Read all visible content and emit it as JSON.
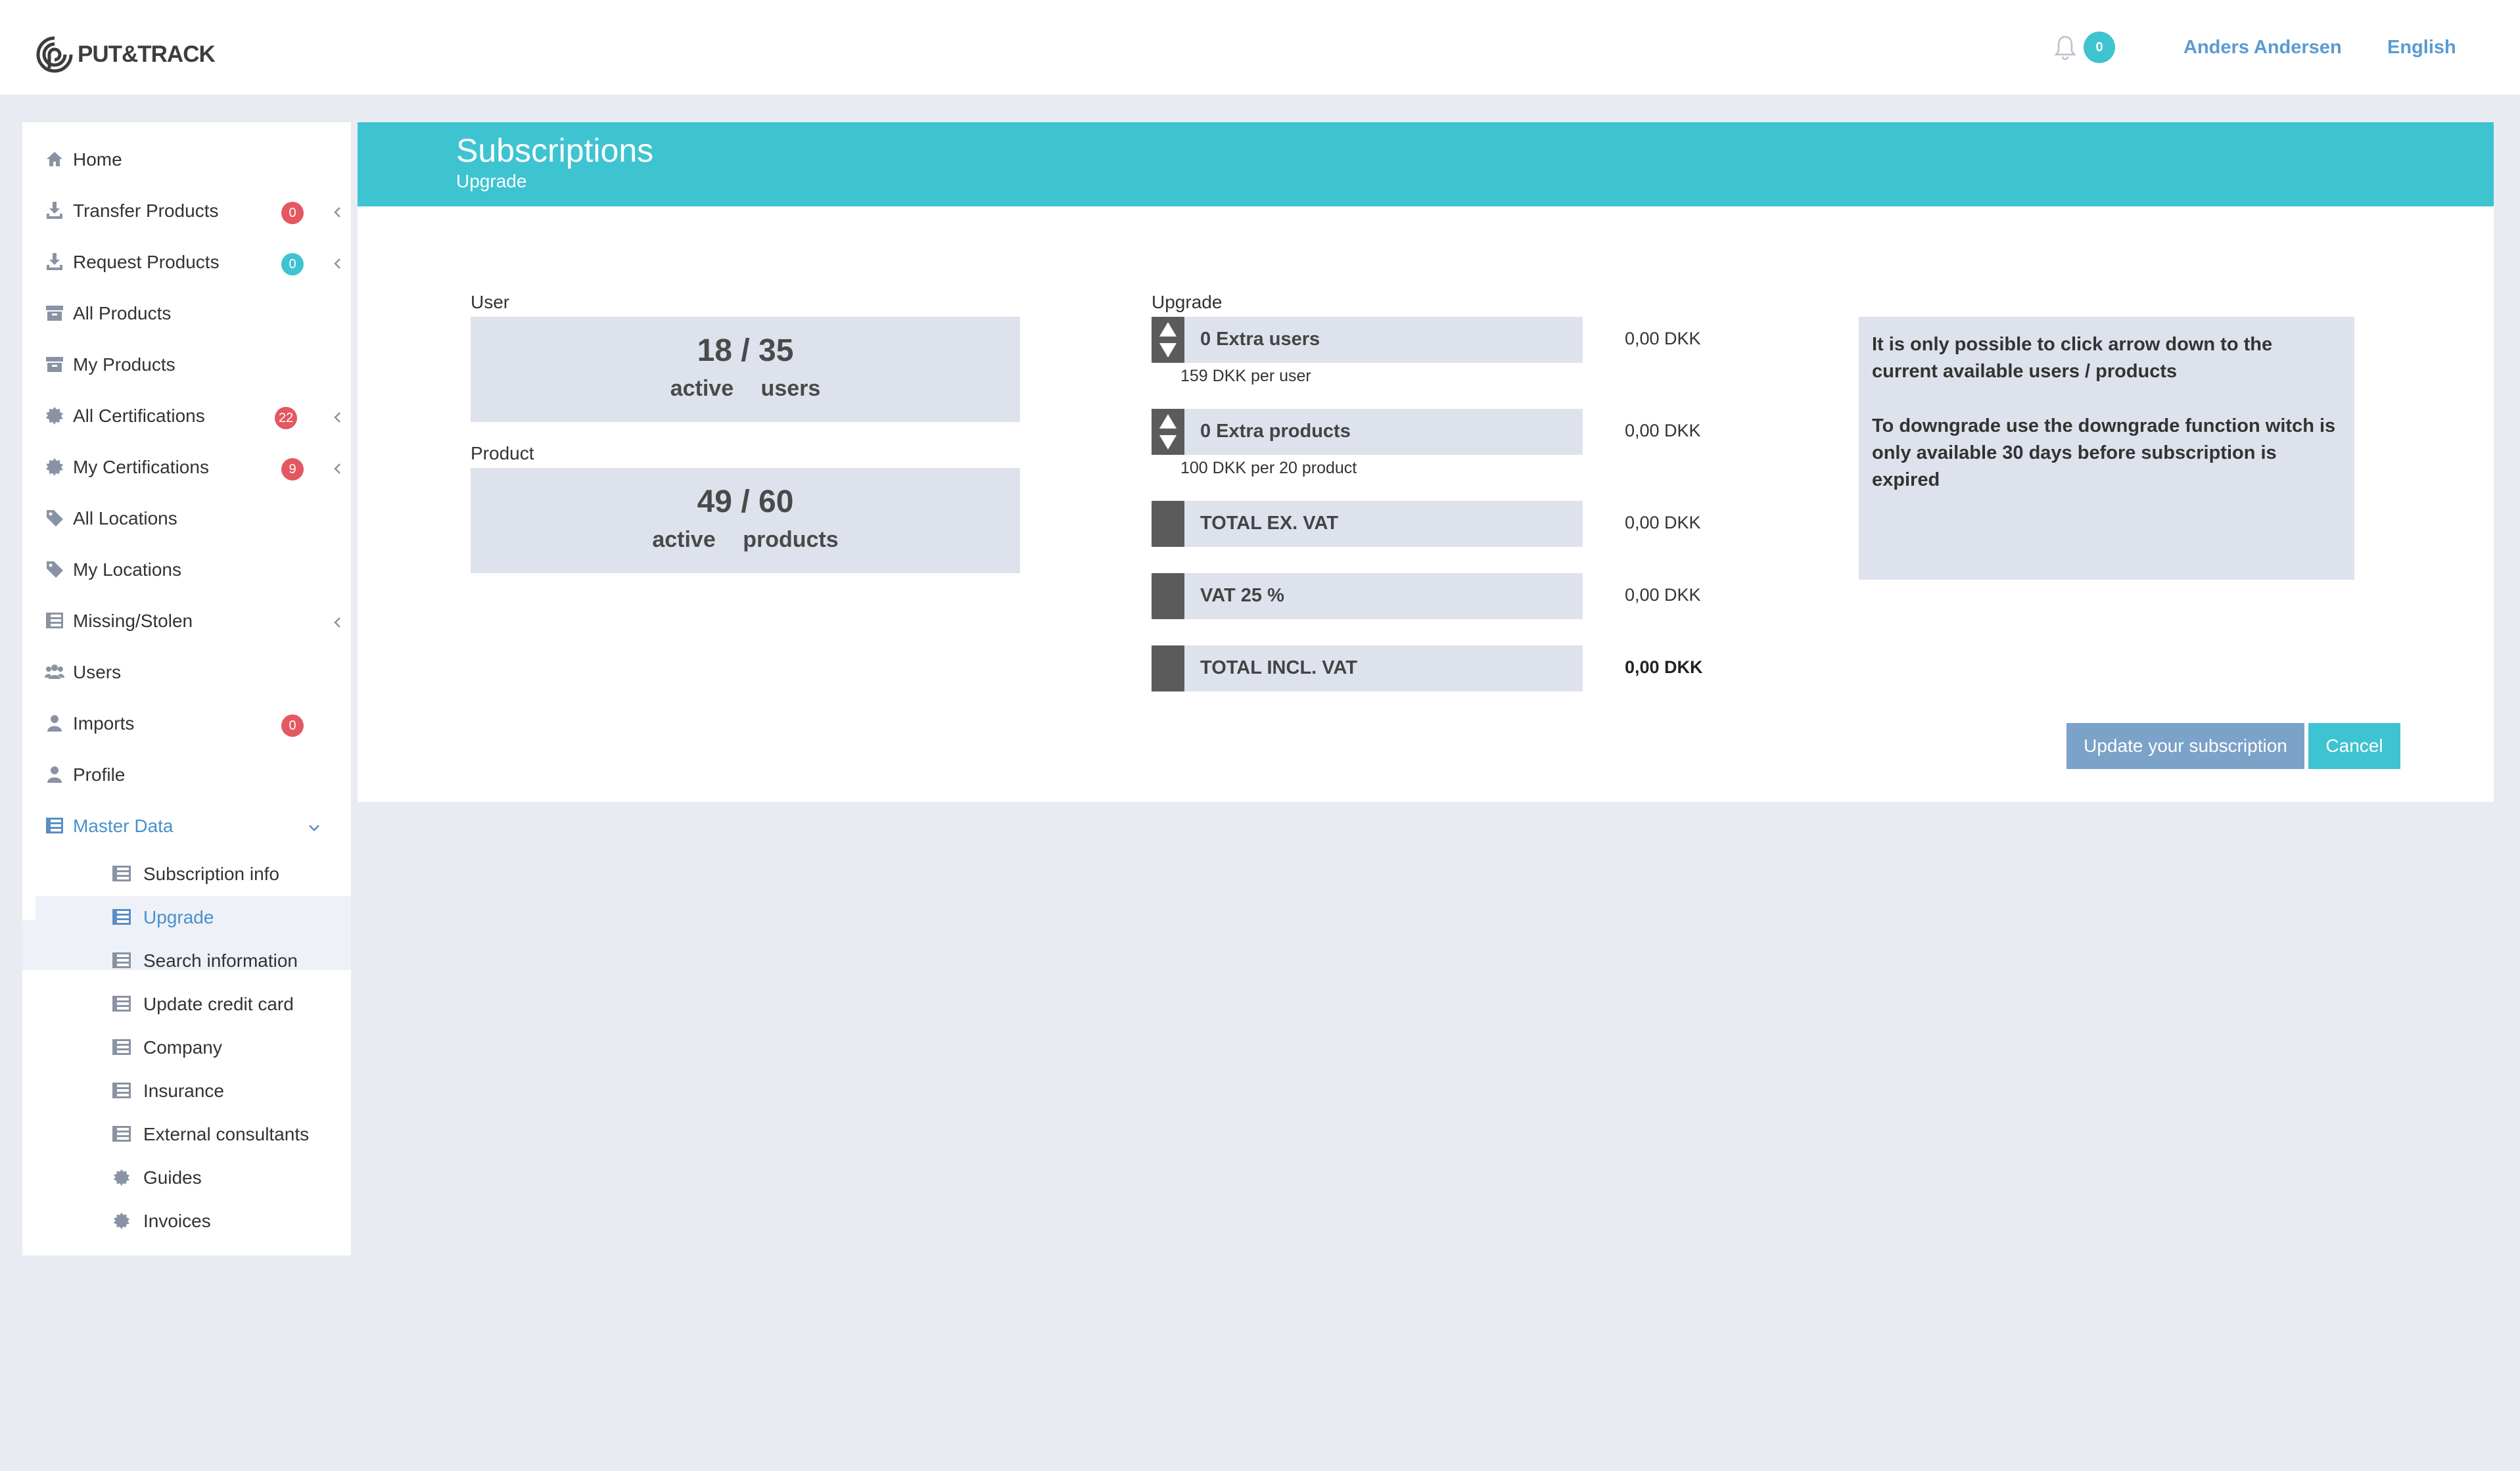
{
  "brand": {
    "logo_text": "PUT&TRACK"
  },
  "header": {
    "notification_count": "0",
    "user_name": "Anders Andersen",
    "language": "English"
  },
  "sidebar": {
    "items": [
      {
        "label": "Home",
        "icon": "home-icon"
      },
      {
        "label": "Transfer Products",
        "icon": "download-icon",
        "badge": "0",
        "badge_color": "#e45862"
      },
      {
        "label": "Request Products",
        "icon": "download-icon",
        "badge": "0",
        "badge_color": "#3ec3d1"
      },
      {
        "label": "All Products",
        "icon": "archive-icon"
      },
      {
        "label": "My Products",
        "icon": "archive-icon"
      },
      {
        "label": "All Certifications",
        "icon": "certificate-icon",
        "badge": "22",
        "badge_color": "#e45862"
      },
      {
        "label": "My Certifications",
        "icon": "certificate-icon",
        "badge": "9",
        "badge_color": "#e45862"
      },
      {
        "label": "All Locations",
        "icon": "tag-icon"
      },
      {
        "label": "My Locations",
        "icon": "tag-icon"
      },
      {
        "label": "Missing/Stolen",
        "icon": "table-icon"
      },
      {
        "label": "Users",
        "icon": "users-icon"
      },
      {
        "label": "Imports",
        "icon": "user-icon",
        "badge": "0",
        "badge_color": "#e45862"
      },
      {
        "label": "Profile",
        "icon": "user-icon"
      },
      {
        "label": "Master Data",
        "icon": "table-icon"
      }
    ],
    "sub_items": [
      {
        "label": "Subscription info",
        "icon": "table-icon"
      },
      {
        "label": "Upgrade",
        "icon": "table-icon"
      },
      {
        "label": "Search information",
        "icon": "table-icon"
      },
      {
        "label": "Update credit card",
        "icon": "table-icon"
      },
      {
        "label": "Company",
        "icon": "table-icon"
      },
      {
        "label": "Insurance",
        "icon": "table-icon"
      },
      {
        "label": "External consultants",
        "icon": "table-icon"
      },
      {
        "label": "Guides",
        "icon": "certificate-icon"
      },
      {
        "label": "Invoices",
        "icon": "certificate-icon"
      }
    ]
  },
  "page": {
    "title": "Subscriptions",
    "subtitle": "Upgrade"
  },
  "usage": {
    "user_label": "User",
    "user_count": "18 / 35",
    "user_desc": "active users",
    "product_label": "Product",
    "product_count": "49 / 60",
    "product_desc": "active products"
  },
  "upgrade": {
    "label": "Upgrade",
    "extra_users": "0 Extra users",
    "extra_users_price": "0,00 DKK",
    "extra_users_note": "159 DKK per user",
    "extra_products": "0 Extra products",
    "extra_products_price": "0,00 DKK",
    "extra_products_note": "100 DKK per 20 product",
    "total_ex_vat": "TOTAL EX. VAT",
    "total_ex_vat_price": "0,00 DKK",
    "vat": "VAT 25 %",
    "vat_price": "0,00 DKK",
    "total_incl_vat": "TOTAL INCL. VAT",
    "total_incl_vat_price": "0,00 DKK"
  },
  "info": {
    "line1": "It is only possible to click arrow down to the current available users / products",
    "line2": "To downgrade use the downgrade function witch is only available 30 days before subscription is expired"
  },
  "actions": {
    "update": "Update your subscription",
    "cancel": "Cancel"
  },
  "colors": {
    "accent": "#3ec3d1",
    "link": "#4a8fcb",
    "badge_red": "#e45862",
    "panel_grey": "#dde2ec"
  }
}
